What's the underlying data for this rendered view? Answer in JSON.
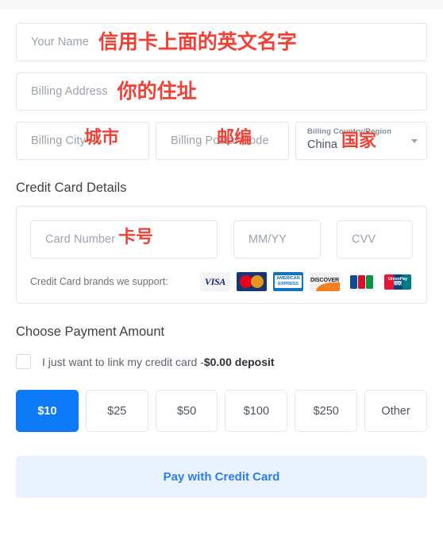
{
  "form": {
    "name_placeholder": "Your Name",
    "name_annotation": "信用卡上面的英文名字",
    "address_placeholder": "Billing Address",
    "address_annotation": "你的住址",
    "city_placeholder": "Billing City",
    "city_annotation": "城市",
    "postal_placeholder": "Billing Postal Code",
    "postal_annotation": "邮编",
    "country_label": "Billing Country/Region",
    "country_value": "China",
    "country_annotation": "国家"
  },
  "credit_card": {
    "heading": "Credit Card Details",
    "card_number_placeholder": "Card Number",
    "card_number_annotation": "卡号",
    "expiry_placeholder": "MM/YY",
    "cvv_placeholder": "CVV",
    "brands_label": "Credit Card brands we support:",
    "brands": [
      {
        "name": "visa",
        "text": "VISA"
      },
      {
        "name": "mastercard",
        "text": "MasterCard"
      },
      {
        "name": "amex",
        "line1": "AMERICAN",
        "line2": "EXPRESS"
      },
      {
        "name": "discover",
        "text": "DISCOVER"
      },
      {
        "name": "jcb",
        "text": "JCB"
      },
      {
        "name": "unionpay",
        "line1": "UnionPay",
        "line2": "银联"
      }
    ]
  },
  "payment": {
    "heading": "Choose Payment Amount",
    "link_card_label": "I just want to link my credit card -",
    "link_card_amount": "$0.00 deposit",
    "checkbox_checked": false,
    "amounts": [
      {
        "label": "$10",
        "selected": true
      },
      {
        "label": "$25",
        "selected": false
      },
      {
        "label": "$50",
        "selected": false
      },
      {
        "label": "$100",
        "selected": false
      },
      {
        "label": "$250",
        "selected": false
      },
      {
        "label": "Other",
        "selected": false
      }
    ],
    "selected_amount": "$10",
    "submit_label": "Pay with Credit Card"
  },
  "colors": {
    "accent": "#0d7bf7",
    "accent_soft_bg": "#eaf2fe",
    "annotation_red": "#ef4136",
    "border": "#e3e6ea",
    "placeholder": "#9aa3ae"
  }
}
